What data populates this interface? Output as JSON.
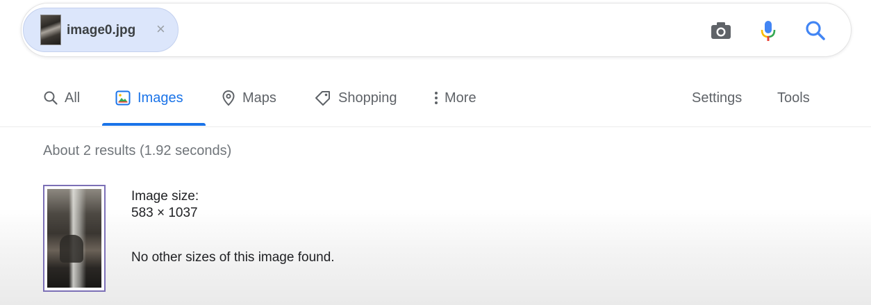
{
  "search": {
    "chip_label": "image0.jpg",
    "chip_close": "×",
    "icons": [
      "camera-icon",
      "microphone-icon",
      "search-icon"
    ]
  },
  "tabs": [
    {
      "label": "All",
      "icon": "search-icon",
      "active": false
    },
    {
      "label": "Images",
      "icon": "image-icon",
      "active": true
    },
    {
      "label": "Maps",
      "icon": "map-pin-icon",
      "active": false
    },
    {
      "label": "Shopping",
      "icon": "tag-icon",
      "active": false
    },
    {
      "label": "More",
      "icon": "vertical-dots-icon",
      "active": false
    }
  ],
  "tools": {
    "settings_label": "Settings",
    "tools_label": "Tools"
  },
  "results": {
    "stats": "About 2 results (1.92 seconds)",
    "image_size_label": "Image size:",
    "image_size_value": "583 × 1037",
    "no_other_sizes": "No other sizes of this image found."
  },
  "colors": {
    "accent": "#1a73e8",
    "chip_bg": "#dce6fb",
    "mic_blue": "#4285f4",
    "mic_red": "#ea4335",
    "mic_yellow": "#fbbc04",
    "mic_green": "#34a853"
  }
}
